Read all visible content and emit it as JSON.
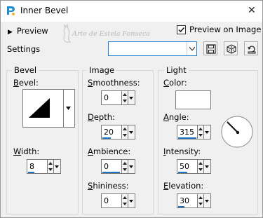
{
  "window": {
    "title": "Inner Bevel",
    "close_glyph": "✕"
  },
  "top": {
    "preview_toggle_label": "Preview",
    "watermark_text": "Arte de Estela Fonseca",
    "preview_on_image_label": "Preview on Image",
    "preview_on_image_checked": true,
    "settings_label": "Settings",
    "settings_value": ""
  },
  "bevel": {
    "group_title": "Bevel",
    "bevel_label": "Bevel:",
    "width_label": "Width:",
    "width_value": "8"
  },
  "image": {
    "group_title": "Image",
    "smoothness_label": "Smoothness:",
    "smoothness_value": "0",
    "depth_label": "Depth:",
    "depth_value": "20",
    "ambience_label": "Ambience:",
    "ambience_value": "0",
    "shininess_label": "Shininess:",
    "shininess_value": "0"
  },
  "light": {
    "group_title": "Light",
    "color_label": "Color:",
    "color_value": "#ffffff",
    "angle_label": "Angle:",
    "angle_value": "315",
    "intensity_label": "Intensity:",
    "intensity_value": "50",
    "elevation_label": "Elevation:",
    "elevation_value": "30"
  },
  "colors": {
    "accent": "#1e72c4",
    "focus_border": "#1e7fd9"
  }
}
